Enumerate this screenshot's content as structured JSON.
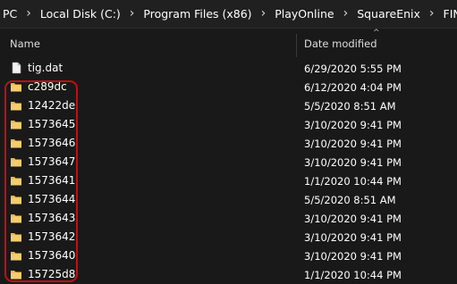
{
  "breadcrumb": [
    "PC",
    "Local Disk (C:)",
    "Program Files (x86)",
    "PlayOnline",
    "SquareEnix",
    "FINAL FANTASY X"
  ],
  "columns": {
    "name": "Name",
    "date_modified": "Date modified",
    "sort_indicator": "^"
  },
  "files": [
    {
      "name": "tig.dat",
      "date": "6/29/2020 5:55 PM",
      "icon": "file-icon"
    },
    {
      "name": "c289dc",
      "date": "6/12/2020 4:04 PM",
      "icon": "folder-icon"
    },
    {
      "name": "12422de",
      "date": "5/5/2020 8:51 AM",
      "icon": "folder-icon"
    },
    {
      "name": "1573645",
      "date": "3/10/2020 9:41 PM",
      "icon": "folder-icon"
    },
    {
      "name": "1573646",
      "date": "3/10/2020 9:41 PM",
      "icon": "folder-icon"
    },
    {
      "name": "1573647",
      "date": "3/10/2020 9:41 PM",
      "icon": "folder-icon"
    },
    {
      "name": "1573641",
      "date": "1/1/2020 10:44 PM",
      "icon": "folder-icon"
    },
    {
      "name": "1573644",
      "date": "5/5/2020 8:51 AM",
      "icon": "folder-icon"
    },
    {
      "name": "1573643",
      "date": "3/10/2020 9:41 PM",
      "icon": "folder-icon"
    },
    {
      "name": "1573642",
      "date": "3/10/2020 9:41 PM",
      "icon": "folder-icon"
    },
    {
      "name": "1573640",
      "date": "3/10/2020 9:41 PM",
      "icon": "folder-icon"
    },
    {
      "name": "15725d8",
      "date": "1/1/2020 10:44 PM",
      "icon": "folder-icon"
    }
  ],
  "colors": {
    "background": "#191919",
    "folder": "#e8b64c",
    "highlight": "#c10f14"
  }
}
